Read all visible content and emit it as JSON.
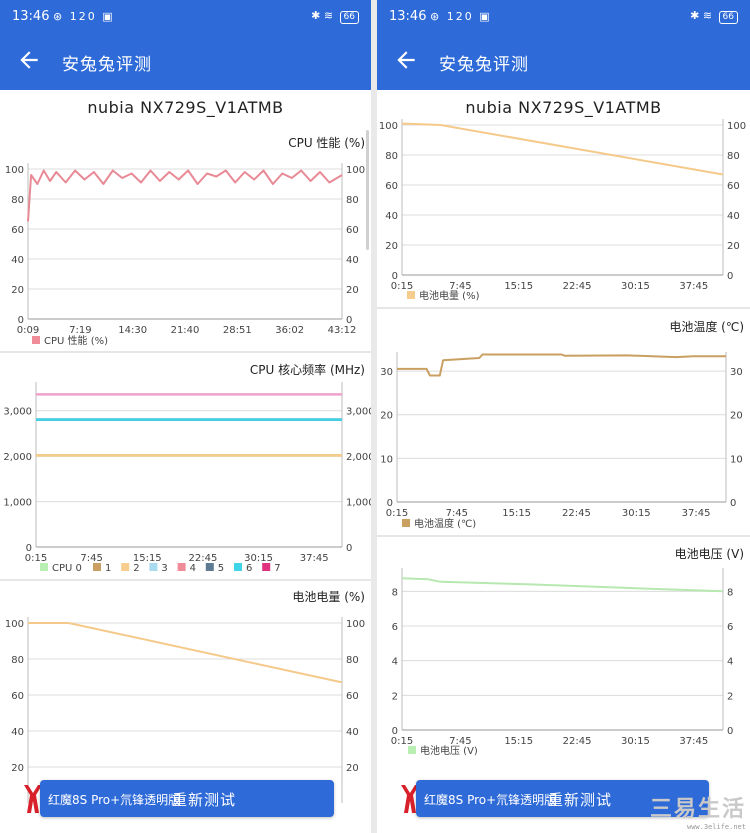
{
  "status_left": {
    "time": "13:46",
    "icons": "⊛ 120 ▣",
    "battery": "66"
  },
  "status_right": {
    "time": "13:46",
    "icons": "⊛ 120 ▣",
    "battery": "66"
  },
  "app": {
    "title": "安兔兔评测",
    "back_icon": "back-arrow-icon"
  },
  "device_name": "nubia NX729S_V1ATMB",
  "button": {
    "label": "重新测试",
    "overlay": "红魔8S Pro+氘锋透明版"
  },
  "watermark": {
    "big": "三易生活",
    "small": "www.3elife.net"
  },
  "colors": {
    "accent": "#2f6bd8",
    "cpu_perf": "#e88a96",
    "battery": "#f5c98a",
    "temp": "#c9a061",
    "voltage": "#b6e8b0"
  },
  "charts": {
    "cpu_perf": {
      "title": "CPU 性能 (%)",
      "legend": [
        {
          "label": "CPU 性能 (%)",
          "color": "#f08c98"
        }
      ]
    },
    "cpu_freq": {
      "title": "CPU 核心频率 (MHz)",
      "legend": [
        {
          "label": "CPU 0",
          "color": "#b9efb2"
        },
        {
          "label": "1",
          "color": "#c9a061"
        },
        {
          "label": "2",
          "color": "#f7cd8e"
        },
        {
          "label": "3",
          "color": "#a9dbef"
        },
        {
          "label": "4",
          "color": "#f08c98"
        },
        {
          "label": "5",
          "color": "#5d7c93"
        },
        {
          "label": "6",
          "color": "#3ed5e8"
        },
        {
          "label": "7",
          "color": "#e0337f"
        }
      ]
    },
    "battery_left": {
      "title": "电池电量 (%)"
    },
    "battery_right": {
      "legend": [
        {
          "label": "电池电量 (%)",
          "color": "#f7cd8e"
        }
      ]
    },
    "battery_temp": {
      "title": "电池温度 (℃)",
      "legend": [
        {
          "label": "电池温度 (℃)",
          "color": "#c9a061"
        }
      ]
    },
    "battery_volt": {
      "title": "电池电压 (V)",
      "legend": [
        {
          "label": "电池电压 (V)",
          "color": "#b9efb2"
        }
      ]
    }
  },
  "chart_data": [
    {
      "type": "line",
      "id": "cpu_perf",
      "ylim": [
        0,
        100
      ],
      "yticks": [
        0,
        20,
        40,
        60,
        80,
        100
      ],
      "x_tick_labels": [
        "0:09",
        "7:19",
        "14:30",
        "21:40",
        "28:51",
        "36:02",
        "43:12"
      ],
      "series": [
        {
          "name": "CPU 性能 (%)",
          "pattern": "starts near 65 at 0:09, jumps to ~96 and fluctuates between ~88 and 100 for the whole run"
        }
      ],
      "points": [
        [
          0,
          65
        ],
        [
          1,
          96
        ],
        [
          3,
          90
        ],
        [
          5,
          99
        ],
        [
          7,
          92
        ],
        [
          9,
          98
        ],
        [
          12,
          91
        ],
        [
          15,
          99
        ],
        [
          18,
          93
        ],
        [
          21,
          98
        ],
        [
          24,
          90
        ],
        [
          27,
          99
        ],
        [
          30,
          94
        ],
        [
          33,
          97
        ],
        [
          36,
          91
        ],
        [
          39,
          99
        ],
        [
          42,
          92
        ],
        [
          45,
          98
        ],
        [
          48,
          93
        ],
        [
          51,
          99
        ],
        [
          54,
          90
        ],
        [
          57,
          97
        ],
        [
          60,
          95
        ],
        [
          63,
          99
        ],
        [
          66,
          91
        ],
        [
          69,
          98
        ],
        [
          72,
          93
        ],
        [
          75,
          99
        ],
        [
          78,
          90
        ],
        [
          81,
          97
        ],
        [
          84,
          94
        ],
        [
          87,
          99
        ],
        [
          90,
          92
        ],
        [
          93,
          98
        ],
        [
          96,
          91
        ],
        [
          100,
          96
        ]
      ]
    },
    {
      "type": "line",
      "id": "cpu_freq",
      "ylim": [
        0,
        3500
      ],
      "yticks": [
        0,
        1000,
        2000,
        3000
      ],
      "ytick_labels": [
        "0",
        "1,000",
        "2,000",
        "3,000"
      ],
      "x_tick_labels": [
        "0:15",
        "7:45",
        "15:15",
        "22:45",
        "30:15",
        "37:45"
      ],
      "series": [
        {
          "name": "CPU 0",
          "values": [
            2016,
            2016
          ]
        },
        {
          "name": "1",
          "values": [
            2016,
            2016
          ]
        },
        {
          "name": "2",
          "values": [
            2016,
            2016
          ]
        },
        {
          "name": "3",
          "values": [
            2803,
            2803
          ]
        },
        {
          "name": "4",
          "values": [
            2803,
            2803
          ]
        },
        {
          "name": "5",
          "values": [
            2803,
            2803
          ]
        },
        {
          "name": "6",
          "values": [
            2803,
            2803
          ]
        },
        {
          "name": "7",
          "values": [
            3360,
            3360
          ]
        }
      ]
    },
    {
      "type": "line",
      "id": "battery_left",
      "ylim": [
        0,
        100
      ],
      "yticks": [
        20,
        40,
        60,
        80,
        100
      ],
      "series": [
        {
          "name": "电池电量 (%)",
          "values": [
            100,
            100,
            67
          ]
        }
      ],
      "points": [
        [
          0,
          100
        ],
        [
          13,
          100
        ],
        [
          100,
          67
        ]
      ]
    },
    {
      "type": "line",
      "id": "battery_right",
      "ylim": [
        0,
        100
      ],
      "yticks": [
        0,
        20,
        40,
        60,
        80,
        100
      ],
      "x_tick_labels": [
        "0:15",
        "7:45",
        "15:15",
        "22:45",
        "30:15",
        "37:45"
      ],
      "series": [
        {
          "name": "电池电量 (%)",
          "values": [
            100,
            67
          ]
        }
      ],
      "points": [
        [
          0,
          101
        ],
        [
          12,
          100
        ],
        [
          100,
          67
        ]
      ]
    },
    {
      "type": "line",
      "id": "battery_temp",
      "ylim": [
        0,
        33
      ],
      "yticks": [
        0,
        10,
        20,
        30
      ],
      "x_tick_labels": [
        "0:15",
        "7:45",
        "15:15",
        "22:45",
        "30:15",
        "37:45"
      ],
      "series": [
        {
          "name": "电池温度 (℃)",
          "pattern": "≈30 at start, dips to ≈29, then steps up to ≈33–34 for the rest"
        }
      ],
      "points": [
        [
          0,
          30.5
        ],
        [
          9,
          30.5
        ],
        [
          10,
          29
        ],
        [
          13,
          29
        ],
        [
          14,
          32.5
        ],
        [
          25,
          33
        ],
        [
          26,
          33.8
        ],
        [
          50,
          33.8
        ],
        [
          51,
          33.5
        ],
        [
          70,
          33.6
        ],
        [
          85,
          33.2
        ],
        [
          90,
          33.4
        ],
        [
          100,
          33.4
        ]
      ]
    },
    {
      "type": "line",
      "id": "battery_volt",
      "ylim": [
        0,
        9
      ],
      "yticks": [
        0,
        2,
        4,
        6,
        8
      ],
      "x_tick_labels": [
        "0:15",
        "7:45",
        "15:15",
        "22:45",
        "30:15",
        "37:45"
      ],
      "series": [
        {
          "name": "电池电压 (V)",
          "pattern": "≈8.7 V declining slowly to ≈8.0 V"
        }
      ],
      "points": [
        [
          0,
          8.75
        ],
        [
          8,
          8.7
        ],
        [
          12,
          8.55
        ],
        [
          40,
          8.4
        ],
        [
          70,
          8.2
        ],
        [
          100,
          8.0
        ]
      ]
    }
  ]
}
